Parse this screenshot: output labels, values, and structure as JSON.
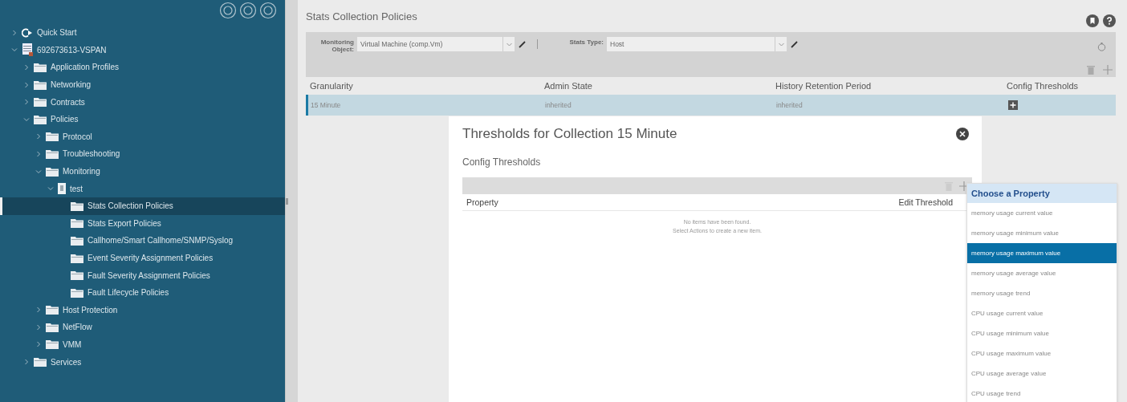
{
  "sidebar": {
    "tree": [
      {
        "label": "Quick Start",
        "kind": "quickstart",
        "expanded": false,
        "selected": false
      },
      {
        "label": "692673613-VSPAN",
        "kind": "tenant",
        "expanded": true,
        "selected": false,
        "children": [
          {
            "label": "Application Profiles",
            "kind": "folder",
            "expanded": false,
            "selected": false
          },
          {
            "label": "Networking",
            "kind": "folder",
            "expanded": false,
            "selected": false
          },
          {
            "label": "Contracts",
            "kind": "folder",
            "expanded": false,
            "selected": false
          },
          {
            "label": "Policies",
            "kind": "folder",
            "expanded": true,
            "selected": false,
            "children": [
              {
                "label": "Protocol",
                "kind": "folder",
                "expanded": false,
                "selected": false
              },
              {
                "label": "Troubleshooting",
                "kind": "folder",
                "expanded": false,
                "selected": false
              },
              {
                "label": "Monitoring",
                "kind": "folder",
                "expanded": true,
                "selected": false,
                "children": [
                  {
                    "label": "test",
                    "kind": "policy",
                    "expanded": true,
                    "selected": false,
                    "children": [
                      {
                        "label": "Stats Collection Policies",
                        "kind": "leaf",
                        "selected": true
                      },
                      {
                        "label": "Stats Export Policies",
                        "kind": "leaf",
                        "selected": false
                      },
                      {
                        "label": "Callhome/Smart Callhome/SNMP/Syslog",
                        "kind": "leaf",
                        "selected": false
                      },
                      {
                        "label": "Event Severity Assignment Policies",
                        "kind": "leaf",
                        "selected": false
                      },
                      {
                        "label": "Fault Severity Assignment Policies",
                        "kind": "leaf",
                        "selected": false
                      },
                      {
                        "label": "Fault Lifecycle Policies",
                        "kind": "leaf",
                        "selected": false
                      }
                    ]
                  }
                ]
              },
              {
                "label": "Host Protection",
                "kind": "folder",
                "expanded": false,
                "selected": false
              },
              {
                "label": "NetFlow",
                "kind": "folder",
                "expanded": false,
                "selected": false
              },
              {
                "label": "VMM",
                "kind": "folder",
                "expanded": false,
                "selected": false
              }
            ]
          },
          {
            "label": "Services",
            "kind": "folder",
            "expanded": false,
            "selected": false
          }
        ]
      }
    ]
  },
  "page": {
    "title": "Stats Collection Policies"
  },
  "filters": [
    {
      "label": "Monitoring Object:",
      "value": "Virtual Machine (comp.Vm)"
    },
    {
      "label": "Stats Type:",
      "value": "Host"
    }
  ],
  "table": {
    "columns": [
      "Granularity",
      "Admin State",
      "History Retention Period",
      "Config Thresholds"
    ],
    "rows": [
      {
        "cells": [
          "15 Minute",
          "inherited",
          "inherited"
        ],
        "selected": true
      }
    ]
  },
  "dialog": {
    "title": "Thresholds for Collection 15 Minute",
    "section": "Config Thresholds",
    "columns": [
      "Property",
      "Edit Threshold"
    ],
    "empty_message": "No items have been found.",
    "empty_hint": "Select Actions to create a new item."
  },
  "property_menu": {
    "title": "Choose a Property",
    "items": [
      {
        "label": "memory usage current value",
        "selected": false
      },
      {
        "label": "memory usage minimum value",
        "selected": false
      },
      {
        "label": "memory usage maximum value",
        "selected": true
      },
      {
        "label": "memory usage average value",
        "selected": false
      },
      {
        "label": "memory usage trend",
        "selected": false
      },
      {
        "label": "CPU usage current value",
        "selected": false
      },
      {
        "label": "CPU usage minimum value",
        "selected": false
      },
      {
        "label": "CPU usage maximum value",
        "selected": false
      },
      {
        "label": "CPU usage average value",
        "selected": false
      },
      {
        "label": "CPU usage trend",
        "selected": false
      }
    ]
  }
}
